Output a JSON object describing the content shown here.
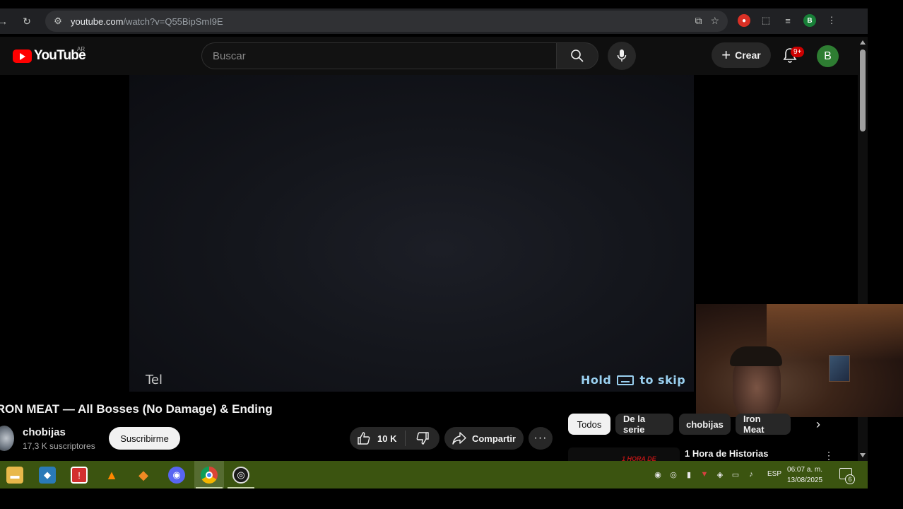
{
  "browser": {
    "url_host": "youtube.com",
    "url_path": "/watch?v=Q55BipSmI9E"
  },
  "header": {
    "logo_text": "YouTube",
    "country": "AR",
    "search_placeholder": "Buscar",
    "create_label": "Crear",
    "notification_badge": "9+",
    "avatar_letter": "B"
  },
  "video": {
    "caption": "Tel",
    "skip_prefix": "Hold",
    "skip_suffix": "to skip",
    "title": "IRON MEAT — All Bosses (No Damage) & Ending"
  },
  "channel": {
    "name": "chobijas",
    "subscribers": "17,3 K suscriptores",
    "subscribe_label": "Suscribirme"
  },
  "actions": {
    "likes": "10 K",
    "share_label": "Compartir",
    "more_label": "···"
  },
  "chips": [
    "Todos",
    "De la serie",
    "chobijas",
    "Iron Meat"
  ],
  "recommended": {
    "title": "1 Hora de Historias",
    "thumb_text": "1 HORA DE"
  },
  "taskbar": {
    "language": "ESP",
    "time": "06:07 a. m.",
    "date": "13/08/2025",
    "notification_count": "6"
  },
  "colors": {
    "yt_red": "#ff0000",
    "taskbar": "#3b5410",
    "skip_text": "#9ad0f0"
  }
}
